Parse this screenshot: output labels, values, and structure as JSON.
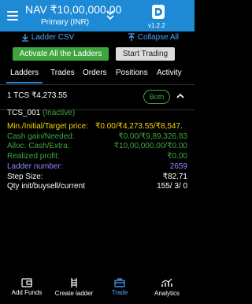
{
  "header": {
    "nav_title": "NAV ₹10,00,000.00",
    "nav_subtitle": "Primary (INR)",
    "version": "v1.2.2"
  },
  "actions": {
    "ladder_csv": "Ladder CSV",
    "collapse_all": "Collapse All",
    "activate_all": "Activate All the Ladders",
    "start_trading": "Start Trading"
  },
  "tabs": [
    {
      "label": "Ladders"
    },
    {
      "label": "Trades"
    },
    {
      "label": "Orders"
    },
    {
      "label": "Positions"
    },
    {
      "label": "Activity"
    }
  ],
  "stock": {
    "title": "1 TCS ₹4,273.55",
    "mode": "Both",
    "instrument": "TCS_001",
    "status": "(Inactive)"
  },
  "details": {
    "target_price_label": "Min./Initial/Target price:",
    "target_price_value": "₹0.00/₹4,273.55/₹8,547.",
    "cash_gain_label": "Cash gain/Needed:",
    "cash_gain_value": "₹0.00/₹9,89,326.83",
    "alloc_cash_label": "Alloc. Cash/Extra:",
    "alloc_cash_value": "₹10,00,000.00/₹0.00",
    "realized_profit_label": "Realized profit:",
    "realized_profit_value": "₹0.00",
    "ladder_number_label": "Ladder number:",
    "ladder_number_value": "2659",
    "step_size_label": "Step Size:",
    "step_size_value": "₹82.71",
    "qty_label": "Qty init/buysell/current",
    "qty_value": "155/ 3/ 0"
  },
  "bottom_nav": [
    {
      "label": "Add Funds"
    },
    {
      "label": "Create ladder"
    },
    {
      "label": "Trade"
    },
    {
      "label": "Analytics"
    }
  ],
  "colors": {
    "accent": "#1e8ad6",
    "green": "#3fa63f",
    "yellow": "#f2d600",
    "label_blue": "#8a8cff"
  }
}
